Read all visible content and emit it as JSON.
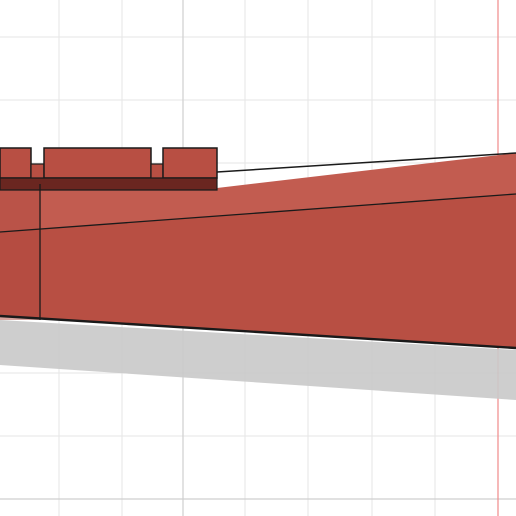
{
  "viewport": {
    "background": "#ffffff",
    "grid_minor_color": "#e6e6e6",
    "grid_major_color": "#cfcfcf",
    "axis_color": "#f08a8a"
  },
  "model": {
    "face_color": "#b84f43",
    "top_color": "#c25c50",
    "dark_color": "#6a2620",
    "edge_color": "#1a1a1a",
    "shadow_color": "#c9c9c9"
  }
}
